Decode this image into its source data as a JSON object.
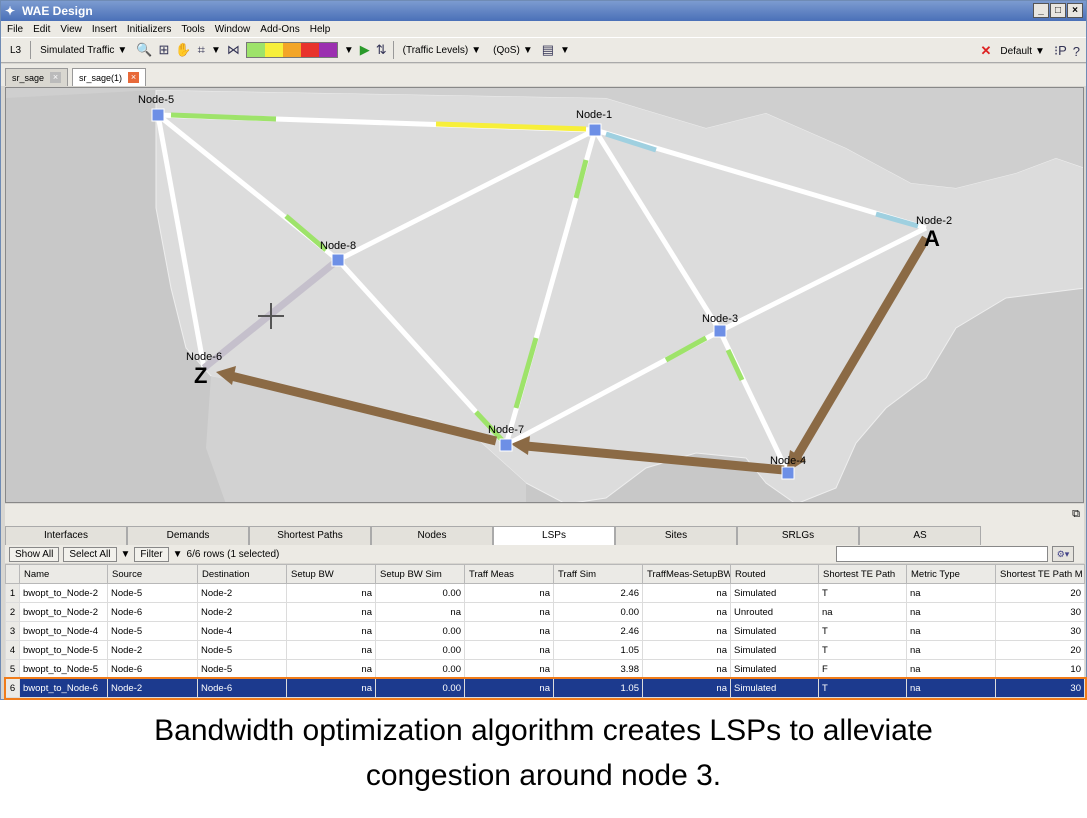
{
  "window": {
    "title": "WAE Design",
    "minimize": "_",
    "maximize": "□",
    "close": "×"
  },
  "menu": [
    "File",
    "Edit",
    "View",
    "Insert",
    "Initializers",
    "Tools",
    "Window",
    "Add-Ons",
    "Help"
  ],
  "toolbar": {
    "layer": "L3",
    "traffic": "Simulated Traffic",
    "traffic_levels": "(Traffic Levels)",
    "qos": "(QoS)",
    "plan": "Default",
    "colors": [
      "#9ee36a",
      "#f7ef3a",
      "#f3a527",
      "#e8322c",
      "#9b2fb0"
    ]
  },
  "doc_tabs": [
    {
      "label": "sr_sage"
    },
    {
      "label": "sr_sage(1)"
    }
  ],
  "map": {
    "nodes": [
      {
        "label": "Node-5"
      },
      {
        "label": "Node-1"
      },
      {
        "label": "Node-2"
      },
      {
        "label": "Node-8"
      },
      {
        "label": "Node-3"
      },
      {
        "label": "Node-6"
      },
      {
        "label": "Node-7"
      },
      {
        "label": "Node-4"
      }
    ],
    "marker_a": "A",
    "marker_z": "Z"
  },
  "panel_tabs": [
    "Interfaces",
    "Demands",
    "Shortest Paths",
    "Nodes",
    "LSPs",
    "Sites",
    "SRLGs",
    "AS"
  ],
  "filter": {
    "show_all": "Show All",
    "select_all": "Select All",
    "filter": "Filter",
    "rows": "6/6 rows (1 selected)"
  },
  "table": {
    "columns": [
      "Name",
      "Source",
      "Destination",
      "Setup BW",
      "Setup BW Sim",
      "Traff Meas",
      "Traff Sim",
      "TraffMeas-SetupBW",
      "Routed",
      "Shortest TE Path",
      "Metric Type",
      "Shortest TE Path M"
    ],
    "rows": [
      [
        "1",
        "bwopt_to_Node-2",
        "Node-5",
        "Node-2",
        "na",
        "0.00",
        "na",
        "2.46",
        "na",
        "Simulated",
        "T",
        "na",
        "20"
      ],
      [
        "2",
        "bwopt_to_Node-2",
        "Node-6",
        "Node-2",
        "na",
        "na",
        "na",
        "0.00",
        "na",
        "Unrouted",
        "na",
        "na",
        "30"
      ],
      [
        "3",
        "bwopt_to_Node-4",
        "Node-5",
        "Node-4",
        "na",
        "0.00",
        "na",
        "2.46",
        "na",
        "Simulated",
        "T",
        "na",
        "30"
      ],
      [
        "4",
        "bwopt_to_Node-5",
        "Node-2",
        "Node-5",
        "na",
        "0.00",
        "na",
        "1.05",
        "na",
        "Simulated",
        "T",
        "na",
        "20"
      ],
      [
        "5",
        "bwopt_to_Node-5",
        "Node-6",
        "Node-5",
        "na",
        "0.00",
        "na",
        "3.98",
        "na",
        "Simulated",
        "F",
        "na",
        "10"
      ],
      [
        "6",
        "bwopt_to_Node-6",
        "Node-2",
        "Node-6",
        "na",
        "0.00",
        "na",
        "1.05",
        "na",
        "Simulated",
        "T",
        "na",
        "30"
      ]
    ]
  },
  "caption": {
    "line1": "Bandwidth optimization algorithm creates LSPs to alleviate",
    "line2": "congestion around node 3."
  }
}
